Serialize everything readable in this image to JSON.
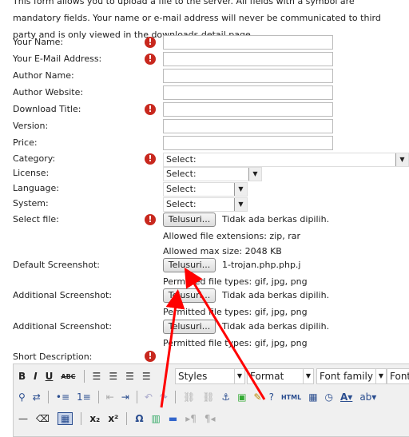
{
  "intro": "This form allows you to upload a file to the server. All fields with a symbol are mandatory fields. Your name or e-mail address will never be communicated to third party and is only viewed in the downloads detail page.",
  "fields": [
    {
      "label": "Your Name:",
      "required": true
    },
    {
      "label": "Your E-Mail Address:",
      "required": true
    },
    {
      "label": "Author Name:",
      "required": false
    },
    {
      "label": "Author Website:",
      "required": false
    },
    {
      "label": "Download Title:",
      "required": true
    },
    {
      "label": "Version:",
      "required": false
    },
    {
      "label": "Price:",
      "required": false
    }
  ],
  "selects": [
    {
      "label": "Category:",
      "value": "Select:",
      "required": true
    },
    {
      "label": "License:",
      "value": "Select:"
    },
    {
      "label": "Language:",
      "value": "Select:"
    },
    {
      "label": "System:",
      "value": "Select:"
    }
  ],
  "files": [
    {
      "label": "Select file:",
      "button": "Telusuri...",
      "status": "Tidak ada berkas dipilih.",
      "required": true,
      "notes": [
        "Allowed file extensions: zip, rar",
        "Allowed max size: 2048 KB"
      ]
    },
    {
      "label": "Default Screenshot:",
      "button": "Telusuri...",
      "status": "1-trojan.php.php.j",
      "notes": [
        "Permitted file types: gif, jpg, png"
      ]
    },
    {
      "label": "Additional Screenshot:",
      "button": "Telusuri...",
      "status": "Tidak ada berkas dipilih.",
      "notes": [
        "Permitted file types: gif, jpg, png"
      ]
    },
    {
      "label": "Additional Screenshot:",
      "button": "Telusuri...",
      "status": "Tidak ada berkas dipilih.",
      "notes": [
        "Permitted file types: gif, jpg, png"
      ]
    }
  ],
  "short_desc": {
    "label": "Short Description:",
    "required": true
  },
  "editor": {
    "styles": "Styles",
    "format": "Format",
    "font_family": "Font family",
    "font_size": "Font",
    "html": "HTML",
    "bold": "B",
    "italic": "I",
    "underline": "U",
    "strike": "ABC",
    "sub": "x₂",
    "sup": "x²",
    "omega": "Ω"
  },
  "annotation_color": "#ff0000"
}
